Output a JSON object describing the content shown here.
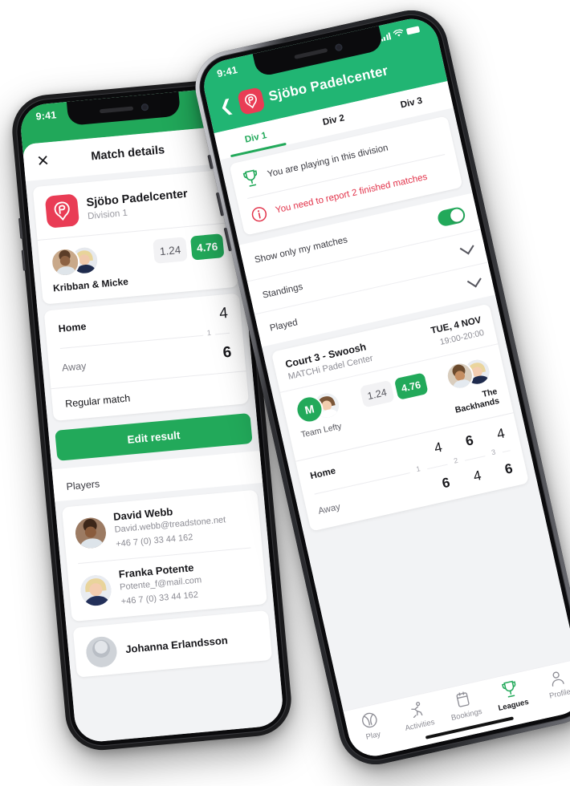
{
  "left_phone": {
    "status_bar": {
      "time": "9:41"
    },
    "header": {
      "close_icon": "close-icon",
      "title": "Match details"
    },
    "venue": {
      "logo_icon": "padel-app-logo",
      "name": "Sjöbo Padelcenter",
      "subtitle": "Division 1"
    },
    "team": {
      "name": "Kribban & Micke",
      "scores": [
        {
          "value": "1.24",
          "highlight": false
        },
        {
          "value": "4.76",
          "highlight": true
        }
      ]
    },
    "result": {
      "home_label": "Home",
      "home_value": "4",
      "set_label": "1",
      "away_label": "Away",
      "away_value": "6",
      "match_type": "Regular match"
    },
    "primary_button": "Edit result",
    "players_section_title": "Players",
    "players": [
      {
        "name": "David Webb",
        "email": "David.webb@treadstone.net",
        "phone": "+46 7 (0) 33 44 162"
      },
      {
        "name": "Franka Potente",
        "email": "Potente_f@mail.com",
        "phone": "+46 7 (0) 33 44 162"
      },
      {
        "name": "Johanna Erlandsson",
        "email": "",
        "phone": ""
      }
    ]
  },
  "right_phone": {
    "status_bar": {
      "time": "9:41",
      "signal_icon": "signal-bars-icon",
      "wifi_icon": "wifi-icon",
      "battery_icon": "battery-icon"
    },
    "nav": {
      "back_icon": "chevron-left-icon",
      "logo_icon": "padel-app-logo",
      "title": "Sjöbo Padelcenter"
    },
    "tabs": [
      {
        "label": "Div 1",
        "active": true
      },
      {
        "label": "Div 2",
        "active": false
      },
      {
        "label": "Div 3",
        "active": false
      }
    ],
    "notices": [
      {
        "icon": "trophy-icon",
        "text": "You are playing in this division",
        "tone": "normal"
      },
      {
        "icon": "info-circle-icon",
        "text": "You need to report 2 finished matches",
        "tone": "red"
      }
    ],
    "filter": {
      "label": "Show only my matches",
      "toggle_on": true
    },
    "accordions": [
      {
        "label": "Standings",
        "icon": "chevron-down-icon"
      },
      {
        "label": "Played",
        "icon": "chevron-down-icon"
      }
    ],
    "match": {
      "court": "Court 3 - Swoosh",
      "venue": "MATCHi Padel Center",
      "date": "TUE, 4 NOV",
      "time": "19:00-20:00",
      "home_team": {
        "name": "Team Lefty",
        "initial": "M"
      },
      "away_team": {
        "name": "The Backhands"
      },
      "odds": [
        {
          "value": "1.24",
          "highlight": false
        },
        {
          "value": "4.76",
          "highlight": true
        }
      ],
      "home_label": "Home",
      "away_label": "Away",
      "set_numbers": [
        "1",
        "2",
        "3"
      ],
      "home_scores": [
        "4",
        "6",
        "4"
      ],
      "away_scores": [
        "6",
        "4",
        "6"
      ]
    },
    "tabbar": [
      {
        "label": "Play",
        "icon": "ball-icon",
        "active": false
      },
      {
        "label": "Activities",
        "icon": "runner-icon",
        "active": false
      },
      {
        "label": "Bookings",
        "icon": "calendar-icon",
        "active": false
      },
      {
        "label": "Leagues",
        "icon": "trophy-icon",
        "active": true
      },
      {
        "label": "Profile",
        "icon": "person-icon",
        "active": false
      }
    ]
  },
  "colors": {
    "brand_green": "#22a95a",
    "header_green": "#21b573",
    "logo_red": "#e93c55",
    "alert_red": "#e2344b",
    "page_bg": "#f2f3f5"
  }
}
